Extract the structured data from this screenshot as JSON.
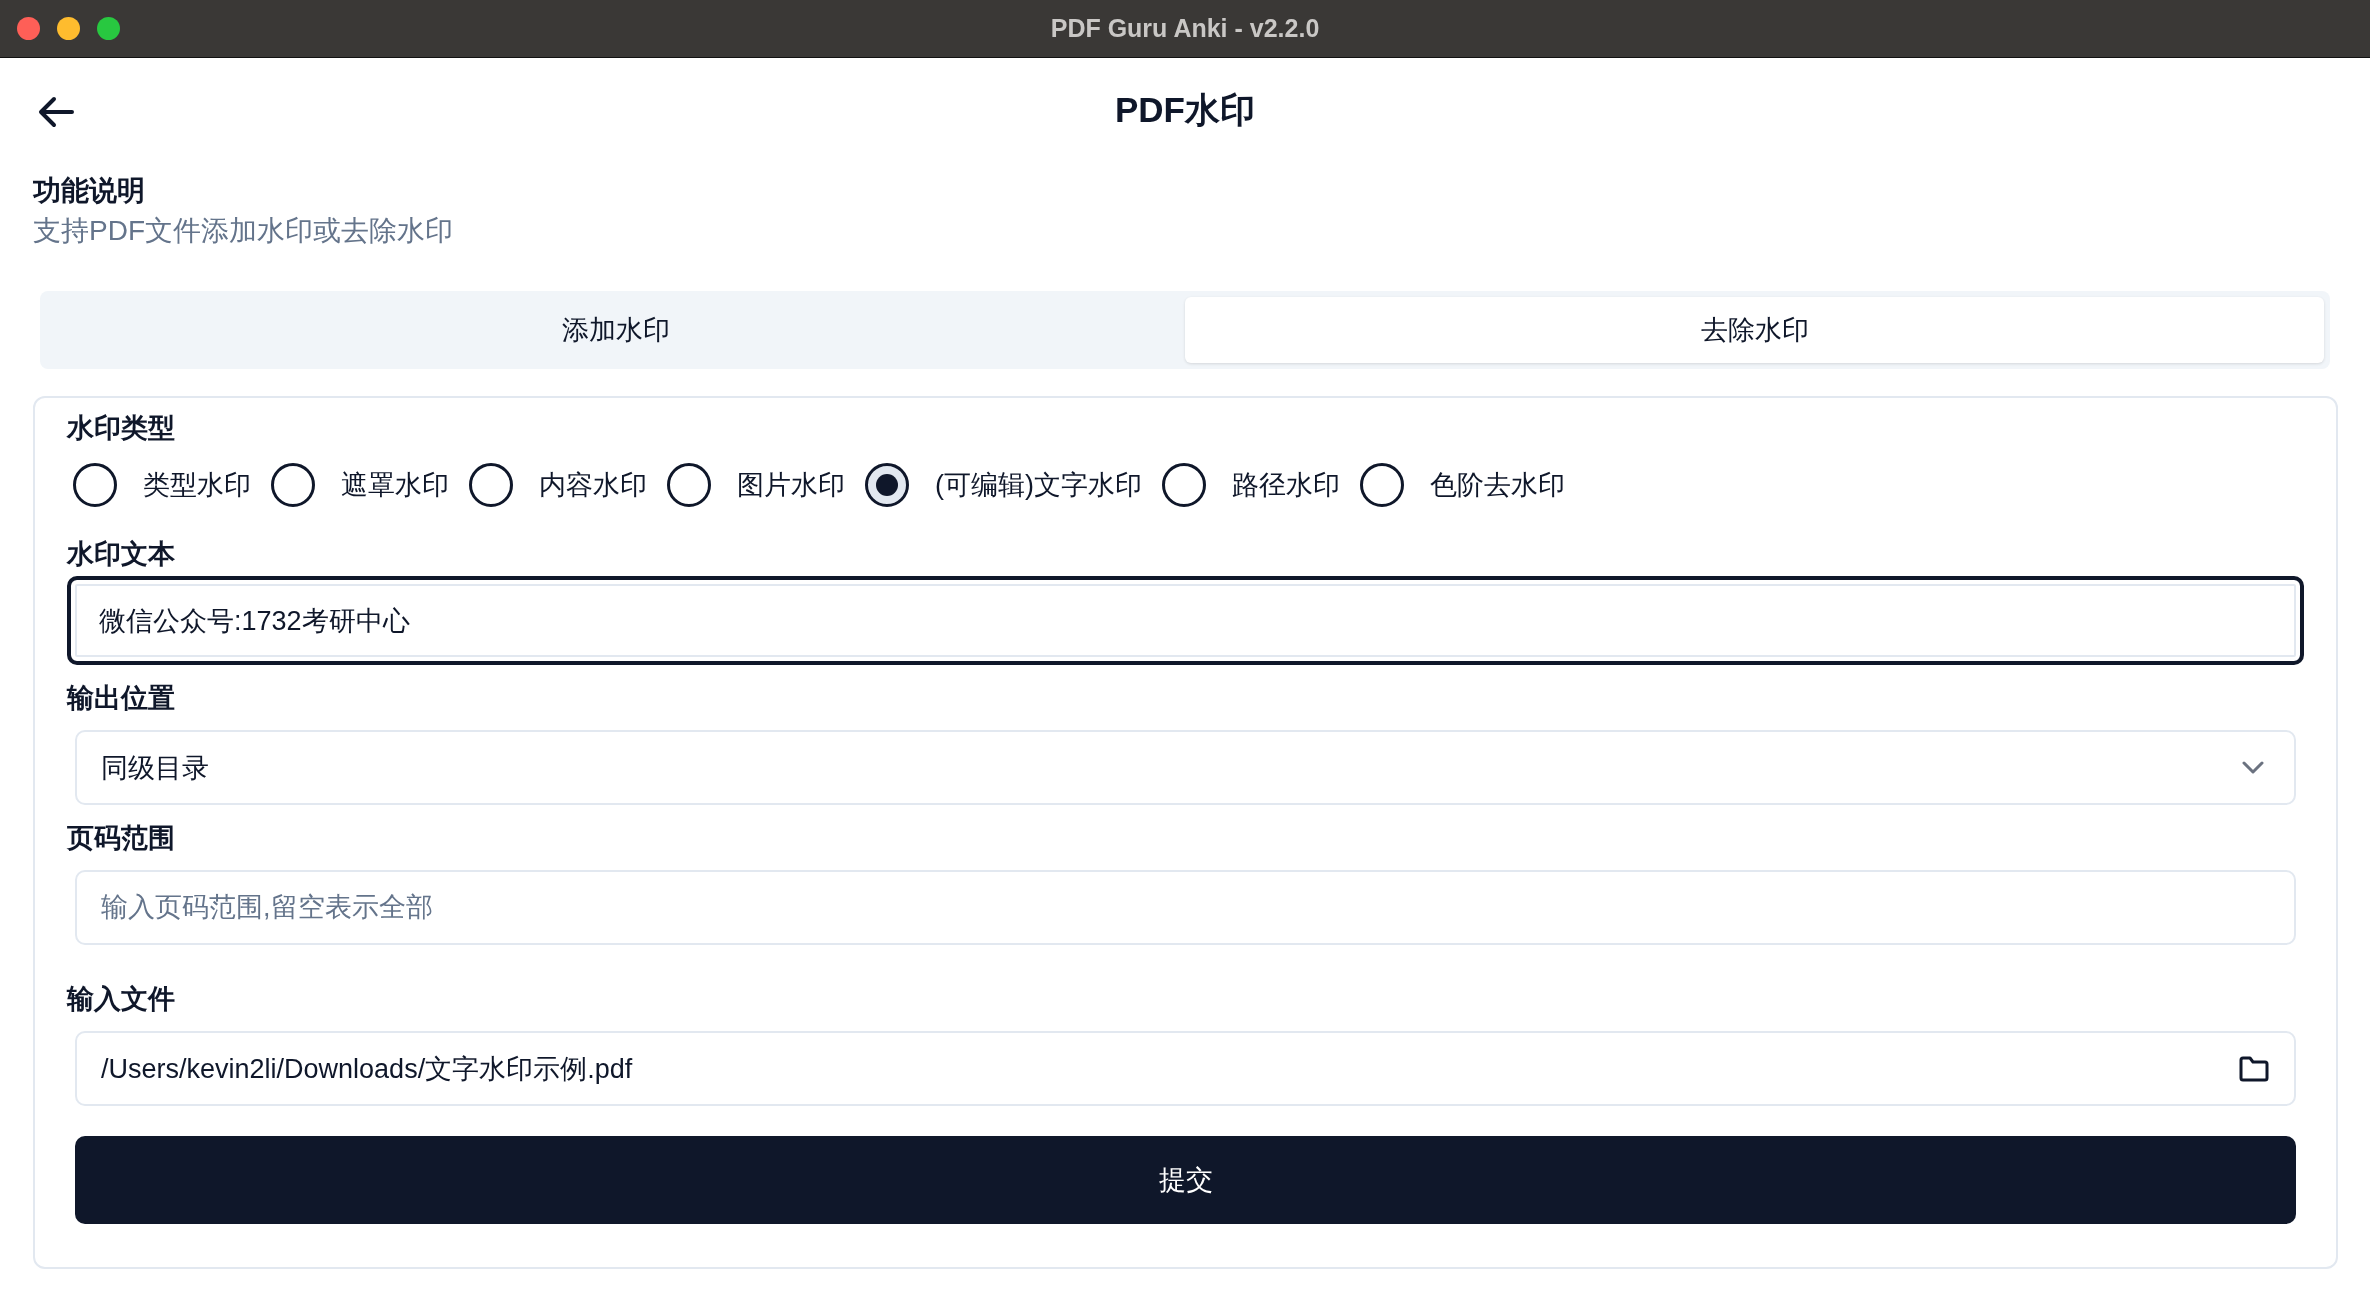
{
  "window": {
    "title": "PDF Guru Anki - v2.2.0"
  },
  "header": {
    "title": "PDF水印"
  },
  "description": {
    "heading": "功能说明",
    "text": "支持PDF文件添加水印或去除水印"
  },
  "tabs": [
    {
      "label": "添加水印",
      "selected": false
    },
    {
      "label": "去除水印",
      "selected": true
    }
  ],
  "form": {
    "watermark_type": {
      "label": "水印类型",
      "options": [
        {
          "label": "类型水印",
          "selected": false
        },
        {
          "label": "遮罩水印",
          "selected": false
        },
        {
          "label": "内容水印",
          "selected": false
        },
        {
          "label": "图片水印",
          "selected": false
        },
        {
          "label": "(可编辑)文字水印",
          "selected": true
        },
        {
          "label": "路径水印",
          "selected": false
        },
        {
          "label": "色阶去水印",
          "selected": false
        }
      ]
    },
    "watermark_text": {
      "label": "水印文本",
      "value": "微信公众号:1732考研中心",
      "focused": true
    },
    "output_location": {
      "label": "输出位置",
      "value": "同级目录"
    },
    "page_range": {
      "label": "页码范围",
      "placeholder": "输入页码范围,留空表示全部"
    },
    "input_file": {
      "label": "输入文件",
      "value": "/Users/kevin2li/Downloads/文字水印示例.pdf"
    },
    "submit": "提交"
  }
}
